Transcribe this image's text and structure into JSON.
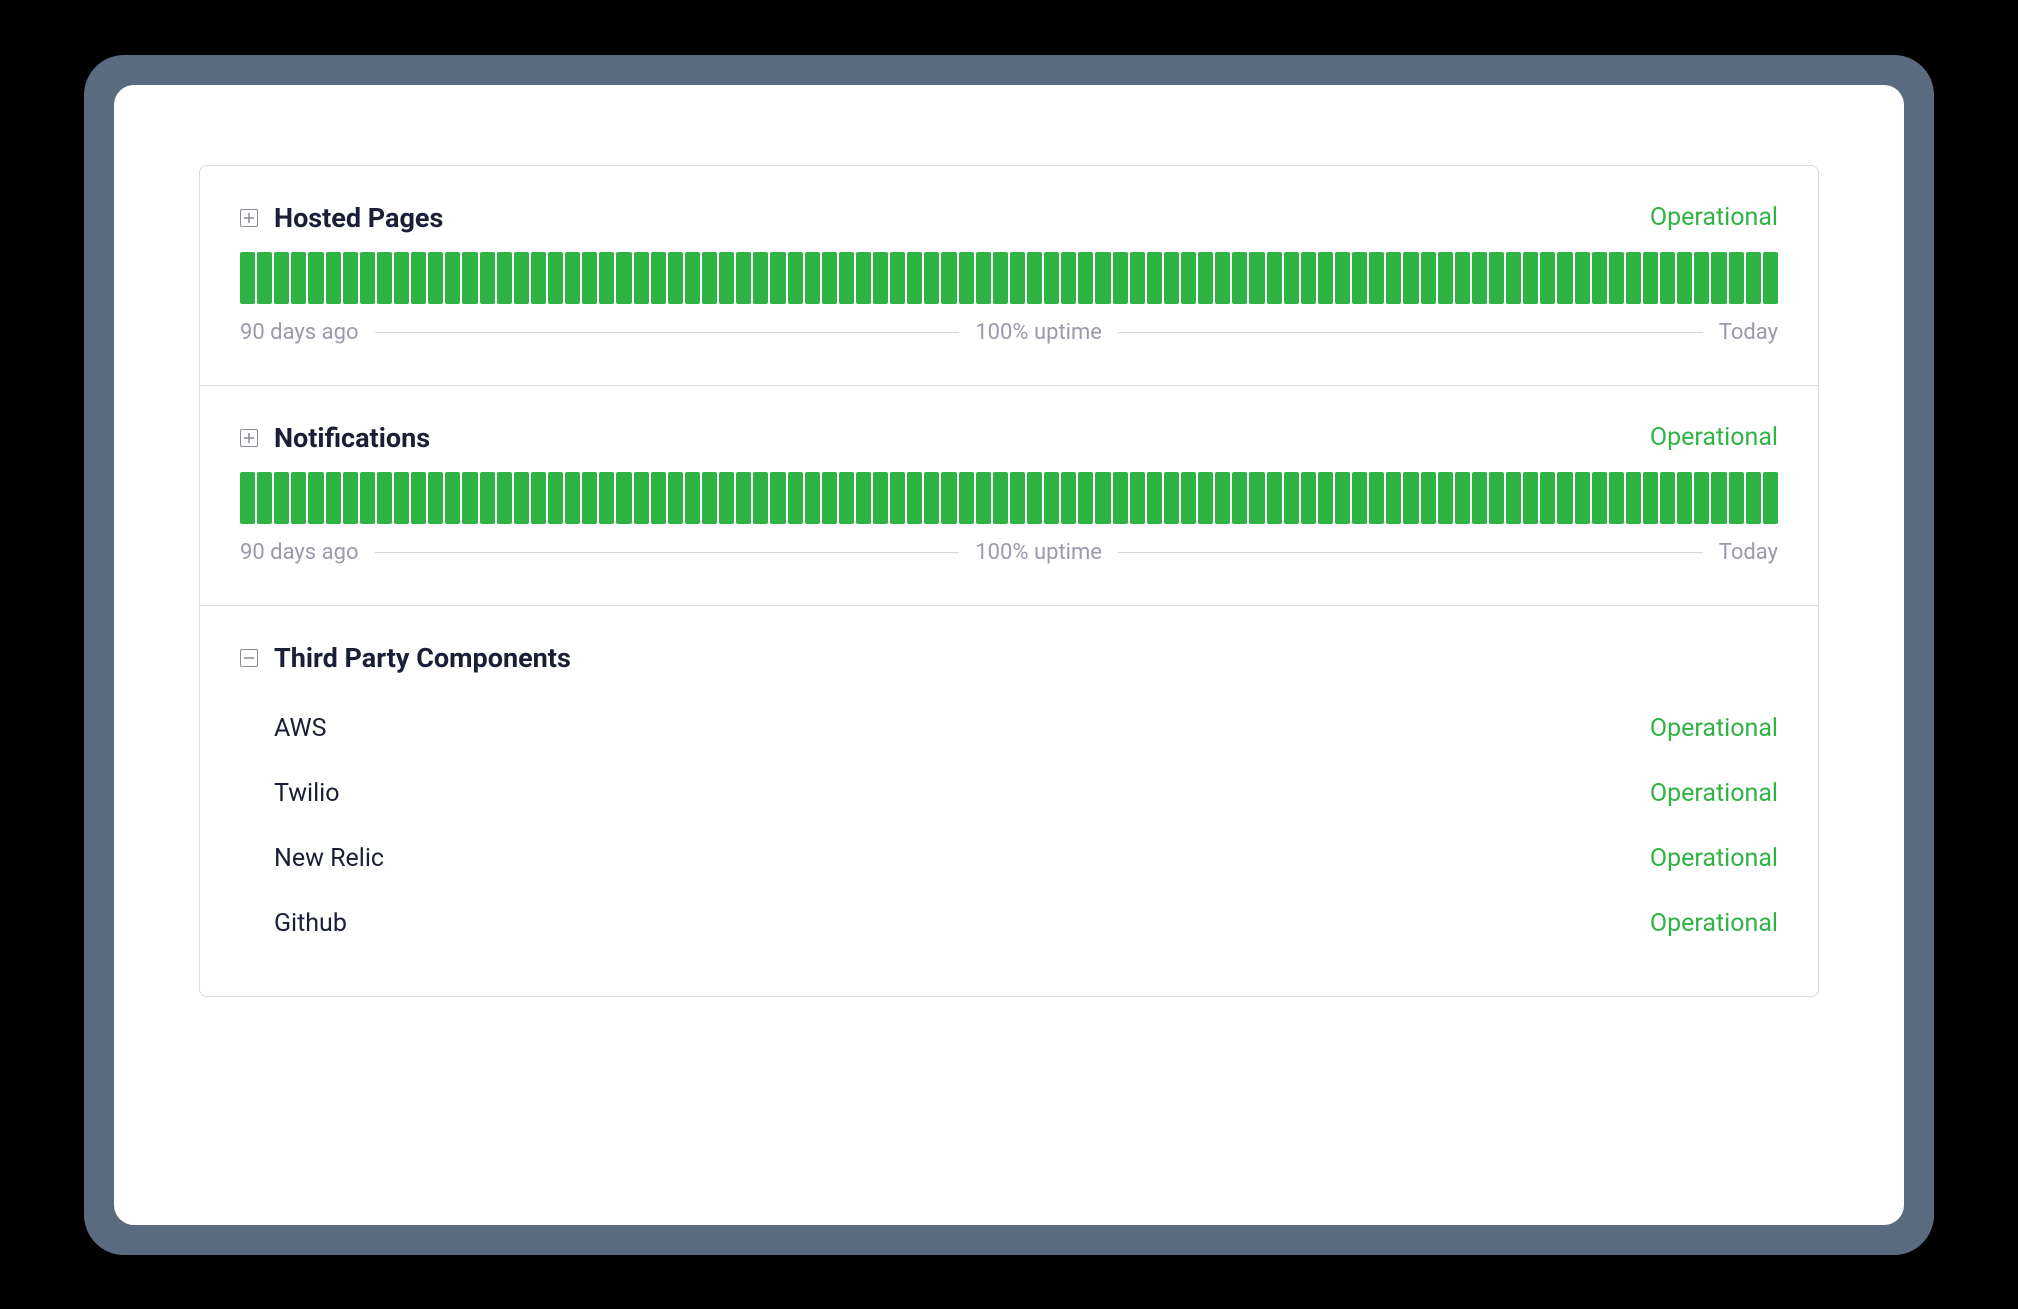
{
  "colors": {
    "operational": "#2fb344",
    "text_dark": "#1a1f36",
    "text_muted": "#9a9aab"
  },
  "legend": {
    "start": "90 days ago",
    "end": "Today"
  },
  "components": [
    {
      "name": "Hosted Pages",
      "status": "Operational",
      "expanded": false,
      "uptime_text": "100% uptime",
      "bar_count": 90,
      "has_chart": true
    },
    {
      "name": "Notifications",
      "status": "Operational",
      "expanded": false,
      "uptime_text": "100% uptime",
      "bar_count": 90,
      "has_chart": true
    },
    {
      "name": "Third Party Components",
      "status": "",
      "expanded": true,
      "has_chart": false,
      "children": [
        {
          "name": "AWS",
          "status": "Operational"
        },
        {
          "name": "Twilio",
          "status": "Operational"
        },
        {
          "name": "New Relic",
          "status": "Operational"
        },
        {
          "name": "Github",
          "status": "Operational"
        }
      ]
    }
  ],
  "chart_data": [
    {
      "type": "bar",
      "title": "Hosted Pages",
      "categories_description": "90 daily uptime bars",
      "values_description": "All 90 bars green (operational)",
      "xlabel_start": "90 days ago",
      "xlabel_end": "Today",
      "summary": "100% uptime"
    },
    {
      "type": "bar",
      "title": "Notifications",
      "categories_description": "90 daily uptime bars",
      "values_description": "All 90 bars green (operational)",
      "xlabel_start": "90 days ago",
      "xlabel_end": "Today",
      "summary": "100% uptime"
    }
  ]
}
